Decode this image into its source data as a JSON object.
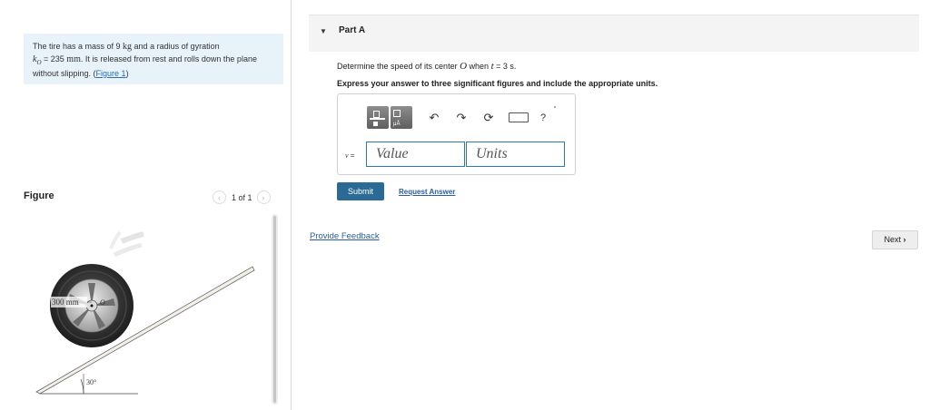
{
  "problem": {
    "text_before_mass": "The tire has a mass of 9 ",
    "mass_unit": "kg",
    "text_after_mass": " and a radius of gyration",
    "k_symbol": "k",
    "k_sub": "O",
    "text_k_value": " = 235 ",
    "k_unit": "mm",
    "text_rest": ". It is released from rest and rolls down the plane without slipping. ",
    "figure_link_open": "(",
    "figure_link": "Figure 1",
    "figure_link_close": ")"
  },
  "figure": {
    "title": "Figure",
    "pager": "1 of 1",
    "prev_icon": "chevron-left-icon",
    "next_icon": "chevron-right-icon",
    "radius_label": "300 mm",
    "center_label": "O",
    "angle_label": "30°"
  },
  "part": {
    "title": "Part A",
    "caret_icon": "triangle-down-icon",
    "question_prefix": "Determine the speed of its center ",
    "question_O": "O",
    "question_when": " when ",
    "question_t": "t",
    "question_suffix": " = 3 s.",
    "instruction": "Express your answer to three significant figures and include the appropriate units."
  },
  "answer": {
    "variable": "v",
    "equals": " =",
    "value_placeholder": "Value",
    "units_placeholder": "Units",
    "toolbar": {
      "template_icon": "fraction-template-icon",
      "units_icon": "units-template-icon",
      "units_text": "μÅ",
      "undo_icon": "undo-icon",
      "redo_icon": "redo-icon",
      "reset_icon": "reset-icon",
      "keyboard_icon": "keyboard-icon",
      "help": "?"
    }
  },
  "buttons": {
    "submit": "Submit",
    "request_answer": "Request Answer",
    "provide_feedback": "Provide Feedback",
    "next": "Next",
    "next_icon": "chevron-right-icon"
  },
  "colors": {
    "accent": "#2a6a94",
    "link": "#2a5d9a",
    "input_border": "#2d78b5",
    "problem_bg": "#e8f2f9"
  }
}
